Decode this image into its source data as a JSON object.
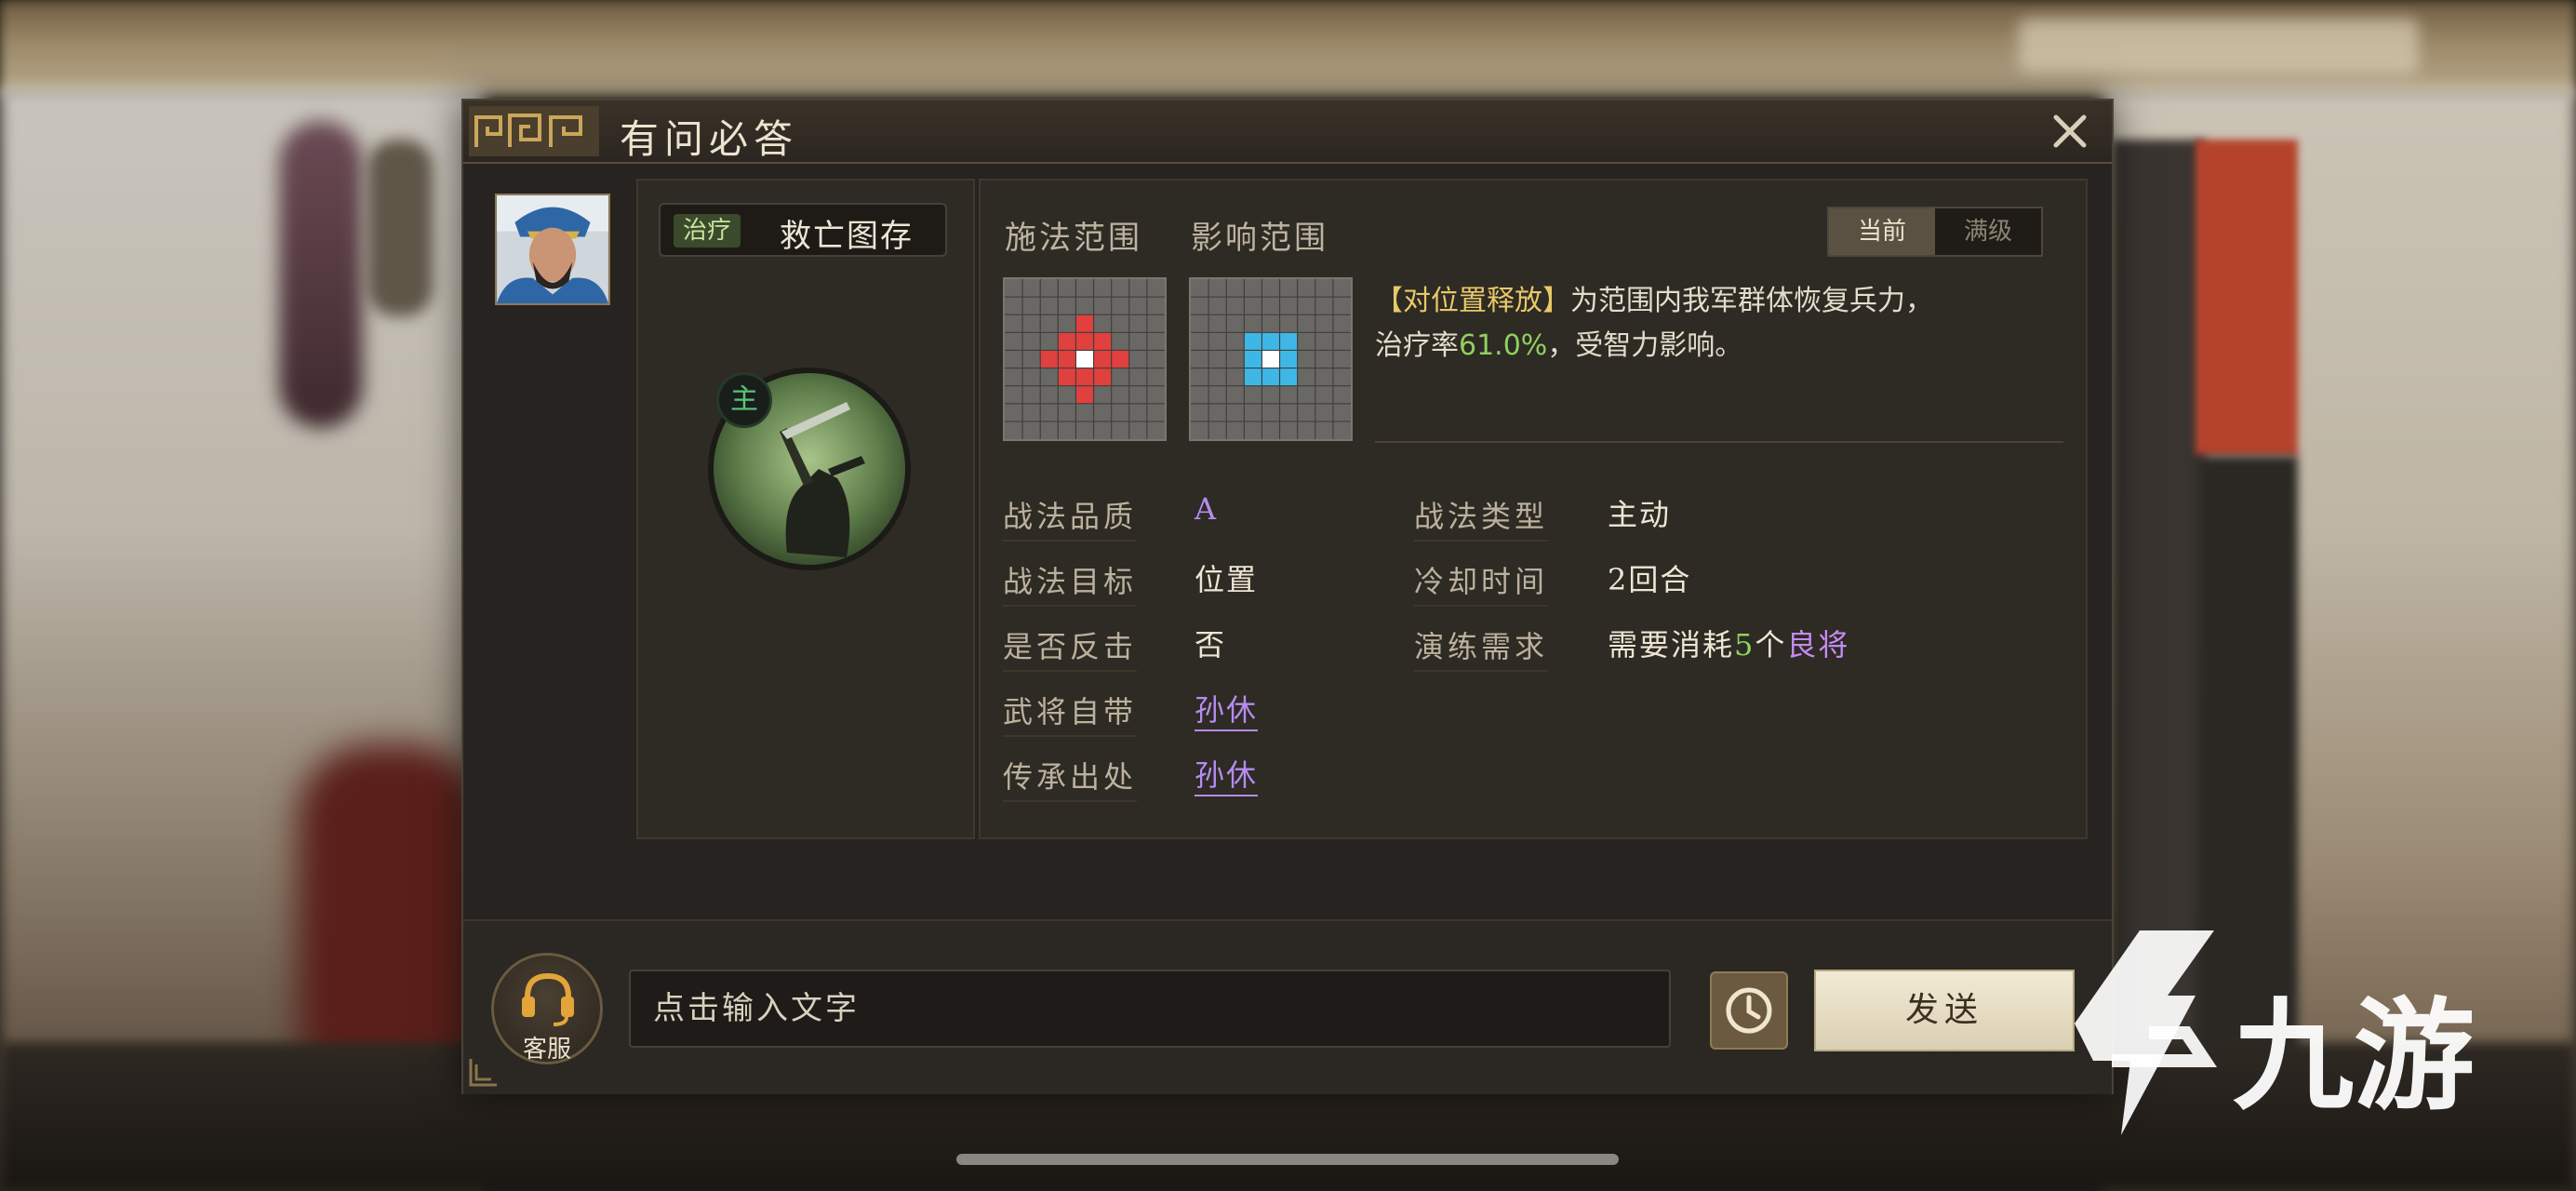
{
  "dialog": {
    "title": "有问必答"
  },
  "skill": {
    "tag": "治疗",
    "name": "救亡图存",
    "badge": "主"
  },
  "range": {
    "cast_label": "施法范围",
    "effect_label": "影响范围",
    "cast_color": "#e0403e",
    "effect_color": "#3fb7e6"
  },
  "level_toggle": {
    "current": "当前",
    "max": "满级"
  },
  "description": {
    "keyword": "【对位置释放】",
    "text1": "为范围内我军群体恢复兵力，",
    "text2": "治疗率",
    "rate": "61.0%",
    "text3": "，受智力影响。"
  },
  "attributes": {
    "quality_label": "战法品质",
    "quality_value": "A",
    "target_label": "战法目标",
    "target_value": "位置",
    "counter_label": "是否反击",
    "counter_value": "否",
    "general_label": "武将自带",
    "general_value": "孙休",
    "inherit_label": "传承出处",
    "inherit_value": "孙休",
    "type_label": "战法类型",
    "type_value": "主动",
    "cooldown_label": "冷却时间",
    "cooldown_value": "2回合",
    "train_label": "演练需求",
    "train_prefix": "需要消耗",
    "train_count": "5",
    "train_unit": "个",
    "train_item": "良将"
  },
  "bottom": {
    "cs_label": "客服",
    "input_placeholder": "点击输入文字",
    "send_label": "发送"
  },
  "icons": [
    "close-icon",
    "headset-icon",
    "clock-icon",
    "general-portrait",
    "skill-icon"
  ],
  "watermark": {
    "text": "九游"
  }
}
